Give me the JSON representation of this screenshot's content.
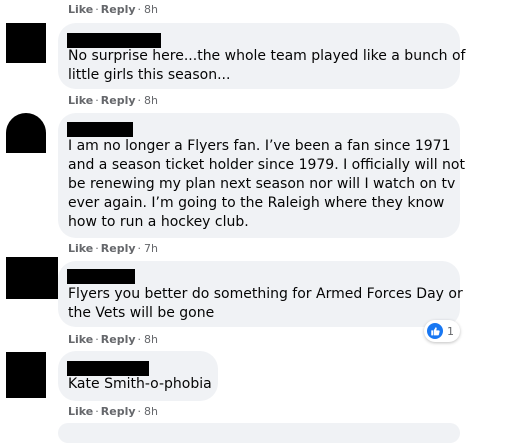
{
  "labels": {
    "like": "Like",
    "separator": "·",
    "reply": "Reply"
  },
  "comments": [
    {
      "text_lines": [],
      "time": "8h"
    },
    {
      "text_lines": [
        "No surprise here...the whole team played like a bunch of",
        "little girls this season..."
      ],
      "time": "8h"
    },
    {
      "text_lines": [
        "I am no longer a Flyers fan. I’ve been a fan since 1971",
        "and a season ticket holder since 1979. I officially will not",
        "be renewing my plan next season nor will I watch on tv",
        "ever again. I’m going to the Raleigh where they know",
        "how to run a hockey club."
      ],
      "time": "7h"
    },
    {
      "text_lines": [
        "Flyers you better do something for Armed Forces Day or",
        "the Vets will be gone"
      ],
      "time": "8h",
      "reactions": {
        "icon": "like-icon",
        "count": "1"
      }
    },
    {
      "text_lines": [
        "Kate Smith-o-phobia"
      ],
      "time": "8h"
    }
  ],
  "colors": {
    "bubble": "#f0f2f5",
    "meta_text": "#65676b",
    "like_blue": "#1877f2",
    "redaction": "#000000"
  }
}
